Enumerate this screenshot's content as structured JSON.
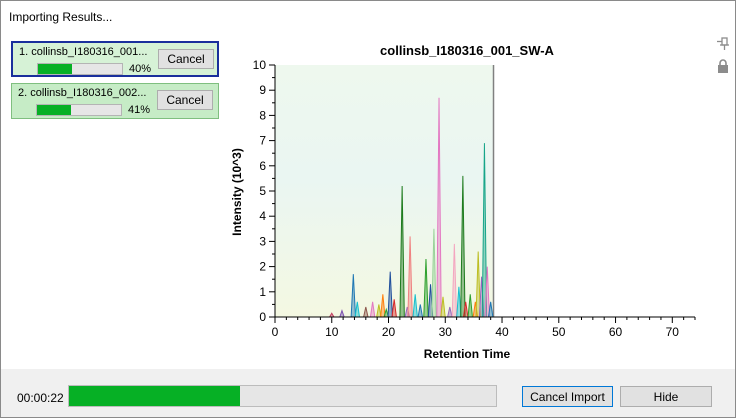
{
  "window": {
    "title": "Importing Results..."
  },
  "jobs": [
    {
      "name": "1. collinsb_I180316_001...",
      "progress": 40,
      "percent_label": "40%",
      "cancel_label": "Cancel",
      "selected": true
    },
    {
      "name": "2. collinsb_I180316_002...",
      "progress": 41,
      "percent_label": "41%",
      "cancel_label": "Cancel",
      "selected": false
    }
  ],
  "side_icons": [
    "pin-icon",
    "lock-icon"
  ],
  "chart_data": {
    "type": "line",
    "title": "collinsb_I180316_001_SW-A",
    "xlabel": "Retention Time",
    "ylabel": "Intensity (10^3)",
    "xlim": [
      0,
      74
    ],
    "ylim": [
      0,
      10
    ],
    "xticks": [
      0,
      10,
      20,
      30,
      40,
      50,
      60,
      70
    ],
    "yticks": [
      0,
      1,
      2,
      3,
      4,
      5,
      6,
      7,
      8,
      9,
      10
    ],
    "acquired_until": 38.5,
    "grid": false,
    "peaks": [
      {
        "rt": 10.0,
        "height": 0.15,
        "color": "#c23b5f"
      },
      {
        "rt": 11.8,
        "height": 0.25,
        "color": "#7a4fb0"
      },
      {
        "rt": 13.8,
        "height": 1.7,
        "color": "#1f77b4"
      },
      {
        "rt": 14.5,
        "height": 0.6,
        "color": "#17becf"
      },
      {
        "rt": 16.0,
        "height": 0.4,
        "color": "#8c564b"
      },
      {
        "rt": 17.2,
        "height": 0.6,
        "color": "#e377c2"
      },
      {
        "rt": 18.3,
        "height": 0.5,
        "color": "#bcbd22"
      },
      {
        "rt": 19.0,
        "height": 0.9,
        "color": "#ff7f0e"
      },
      {
        "rt": 19.6,
        "height": 0.3,
        "color": "#2ca02c"
      },
      {
        "rt": 20.3,
        "height": 1.8,
        "color": "#1f4e9c"
      },
      {
        "rt": 21.0,
        "height": 0.7,
        "color": "#d62728"
      },
      {
        "rt": 22.4,
        "height": 5.2,
        "color": "#1e7b1e"
      },
      {
        "rt": 23.3,
        "height": 0.4,
        "color": "#9467bd"
      },
      {
        "rt": 23.8,
        "height": 3.2,
        "color": "#f08080"
      },
      {
        "rt": 24.7,
        "height": 0.9,
        "color": "#17becf"
      },
      {
        "rt": 25.6,
        "height": 0.5,
        "color": "#1f77b4"
      },
      {
        "rt": 26.6,
        "height": 2.3,
        "color": "#2ca02c"
      },
      {
        "rt": 27.4,
        "height": 1.3,
        "color": "#1f4e9c"
      },
      {
        "rt": 28.0,
        "height": 3.5,
        "color": "#9ad39a"
      },
      {
        "rt": 28.9,
        "height": 8.7,
        "color": "#e377c2"
      },
      {
        "rt": 29.6,
        "height": 0.8,
        "color": "#bcbd22"
      },
      {
        "rt": 30.8,
        "height": 0.4,
        "color": "#9467bd"
      },
      {
        "rt": 31.6,
        "height": 2.9,
        "color": "#f4a6c0"
      },
      {
        "rt": 32.4,
        "height": 1.2,
        "color": "#17becf"
      },
      {
        "rt": 33.1,
        "height": 5.6,
        "color": "#1e7b1e"
      },
      {
        "rt": 33.6,
        "height": 0.6,
        "color": "#d62728"
      },
      {
        "rt": 34.4,
        "height": 0.9,
        "color": "#2ca02c"
      },
      {
        "rt": 35.3,
        "height": 0.6,
        "color": "#ff7f0e"
      },
      {
        "rt": 35.8,
        "height": 2.6,
        "color": "#bcbd22"
      },
      {
        "rt": 36.4,
        "height": 1.6,
        "color": "#9467bd"
      },
      {
        "rt": 36.9,
        "height": 6.9,
        "color": "#17a589"
      },
      {
        "rt": 37.4,
        "height": 2.0,
        "color": "#e377c2"
      },
      {
        "rt": 38.0,
        "height": 0.6,
        "color": "#1f77b4"
      }
    ]
  },
  "footer": {
    "elapsed": "00:00:22",
    "progress": 40,
    "cancel_import_label": "Cancel Import",
    "hide_label": "Hide"
  }
}
